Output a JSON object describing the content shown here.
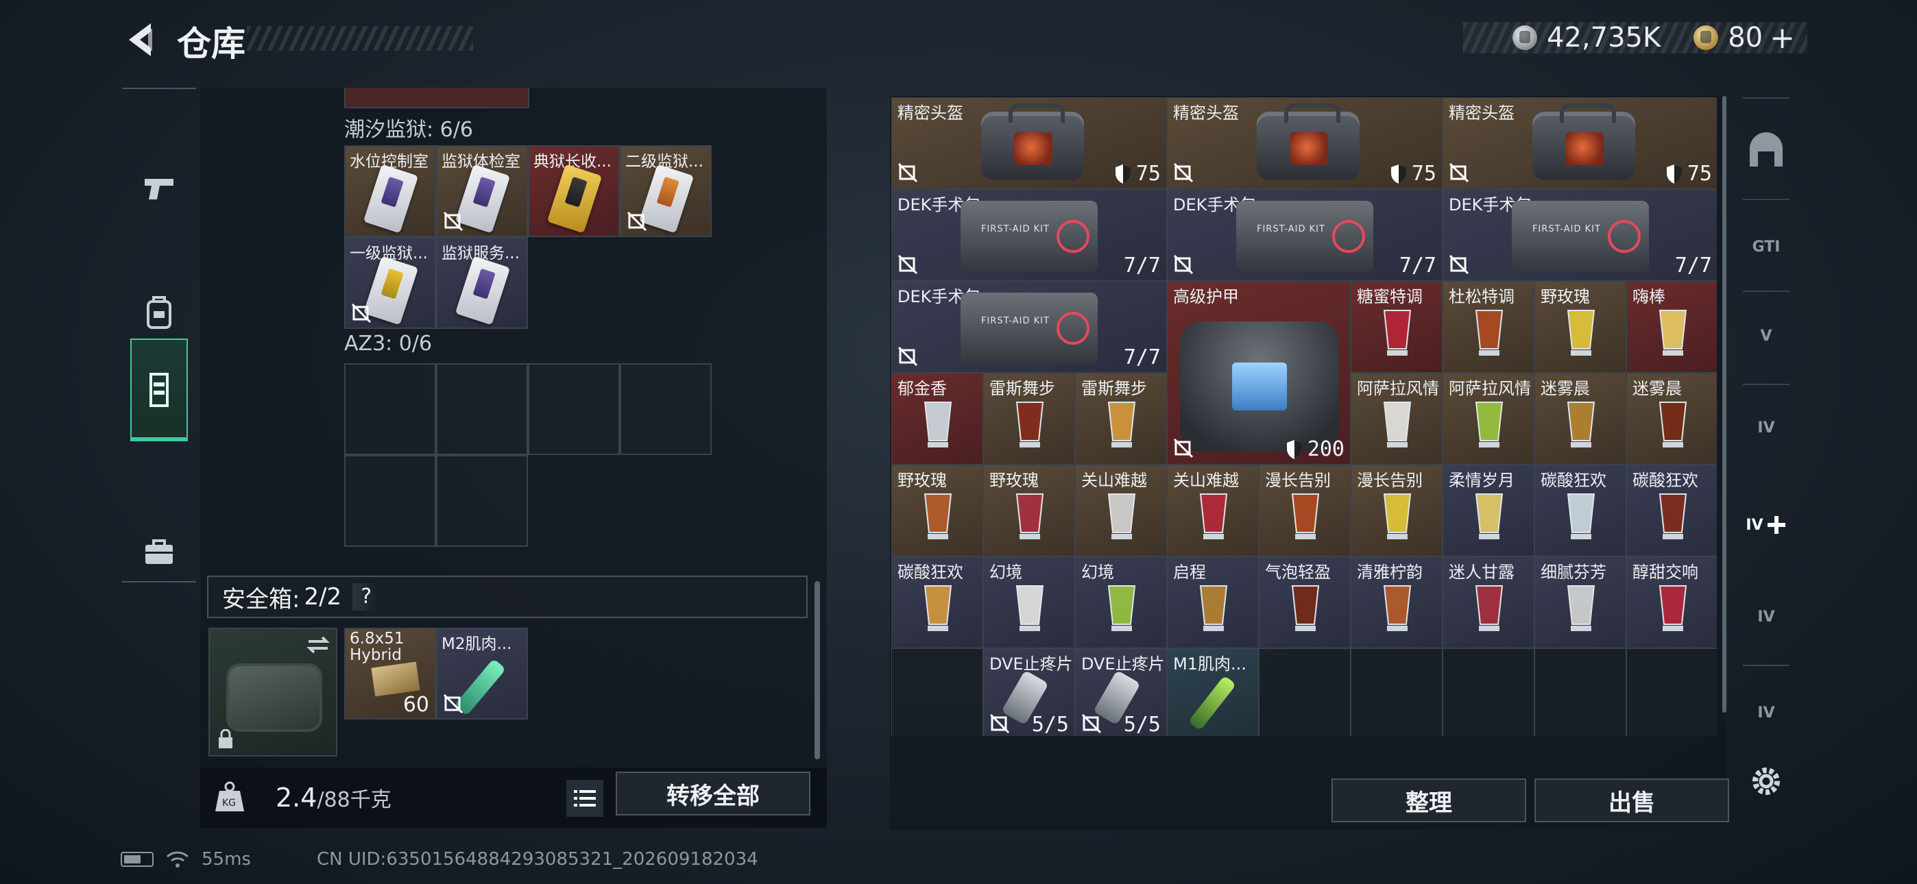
{
  "header": {
    "title": "仓库",
    "currency_silver": "42,735K",
    "currency_gold": "80",
    "plus": "+"
  },
  "left_tabs": [
    {
      "icon": "pistol-icon"
    },
    {
      "icon": "backpack-icon"
    },
    {
      "icon": "vest-icon",
      "active": true
    },
    {
      "icon": "briefcase-icon"
    }
  ],
  "groups": {
    "tide_prison": {
      "label": "潮汐监狱: 6/6",
      "items": [
        {
          "name": "水位控制室",
          "color": "tan",
          "card": "purple"
        },
        {
          "name": "监狱体检室",
          "color": "tan",
          "card": "purple",
          "nobind": true
        },
        {
          "name": "典狱长收...",
          "color": "red",
          "card": "gold"
        },
        {
          "name": "二级监狱...",
          "color": "tan",
          "card": "orange",
          "nobind": true
        },
        {
          "name": "一级监狱...",
          "color": "blue",
          "card": "yellow",
          "nobind": true
        },
        {
          "name": "监狱服务...",
          "color": "blue",
          "card": "purple"
        }
      ]
    },
    "az3": {
      "label": "AZ3: 0/6"
    }
  },
  "safebox": {
    "label": "安全箱:",
    "count": "2/2",
    "help": "?",
    "items": [
      {
        "name": "6.8x51 Hybrid",
        "qty": "60"
      },
      {
        "name": "M2肌肉..."
      }
    ]
  },
  "weight": {
    "current": "2.4",
    "max": "/88千克"
  },
  "buttons": {
    "transfer_all": "转移全部",
    "sort": "整理",
    "sell": "出售"
  },
  "stash": {
    "row0": [
      {
        "name": "精密头盔",
        "value": "75"
      },
      {
        "name": "精密头盔",
        "value": "75"
      },
      {
        "name": "精密头盔",
        "value": "75"
      }
    ],
    "row1": [
      {
        "name": "DEK手术包",
        "value": "7/7"
      },
      {
        "name": "DEK手术包",
        "value": "7/7"
      },
      {
        "name": "DEK手术包",
        "value": "7/7"
      }
    ],
    "row2_kit": {
      "name": "DEK手术包",
      "value": "7/7"
    },
    "armor": {
      "name": "高级护甲",
      "value": "200"
    },
    "drinks_row2": [
      {
        "name": "糖蜜特调",
        "color": "red"
      },
      {
        "name": "杜松特调",
        "color": "tan"
      },
      {
        "name": "野玫瑰",
        "color": "tan"
      },
      {
        "name": "嗨棒",
        "color": "red"
      }
    ],
    "drinks_row3a": [
      {
        "name": "郁金香",
        "color": "red"
      },
      {
        "name": "雷斯舞步",
        "color": "tan"
      },
      {
        "name": "雷斯舞步",
        "color": "tan"
      }
    ],
    "drinks_row3b": [
      {
        "name": "阿萨拉风情",
        "color": "tan"
      },
      {
        "name": "阿萨拉风情",
        "color": "tan"
      },
      {
        "name": "迷雾晨",
        "color": "tan"
      },
      {
        "name": "迷雾晨",
        "color": "tan"
      }
    ],
    "drinks_row4": [
      {
        "name": "野玫瑰",
        "color": "tan"
      },
      {
        "name": "野玫瑰",
        "color": "tan"
      },
      {
        "name": "关山难越",
        "color": "tan"
      },
      {
        "name": "关山难越",
        "color": "tan"
      },
      {
        "name": "漫长告别",
        "color": "tan"
      },
      {
        "name": "漫长告别",
        "color": "tan"
      },
      {
        "name": "柔情岁月",
        "color": "blue"
      },
      {
        "name": "碳酸狂欢",
        "color": "blue"
      },
      {
        "name": "碳酸狂欢",
        "color": "blue"
      }
    ],
    "drinks_row5": [
      {
        "name": "碳酸狂欢",
        "color": "blue"
      },
      {
        "name": "幻境",
        "color": "blue"
      },
      {
        "name": "幻境",
        "color": "blue"
      },
      {
        "name": "启程",
        "color": "blue"
      },
      {
        "name": "气泡轻盈",
        "color": "blue"
      },
      {
        "name": "清雅柠韵",
        "color": "blue"
      },
      {
        "name": "迷人甘露",
        "color": "blue"
      },
      {
        "name": "细腻芬芳",
        "color": "blue"
      },
      {
        "name": "醇甜交响",
        "color": "blue"
      }
    ],
    "row6": [
      {
        "name": "DVE止疼片",
        "value": "5/5"
      },
      {
        "name": "DVE止疼片",
        "value": "5/5"
      },
      {
        "name": "M1肌肉..."
      }
    ]
  },
  "right_tabs": [
    "dome-icon",
    "GTI",
    "V",
    "IV",
    "IV",
    "IV",
    "IV"
  ],
  "status": {
    "ping": "55ms",
    "uid": "CN UID:63501564884293085321_202609182034"
  },
  "colors": {
    "accent": "#3ec9a0",
    "tan": "#5a4a38",
    "red": "#6a2c2c",
    "blue": "#3a3d52"
  }
}
